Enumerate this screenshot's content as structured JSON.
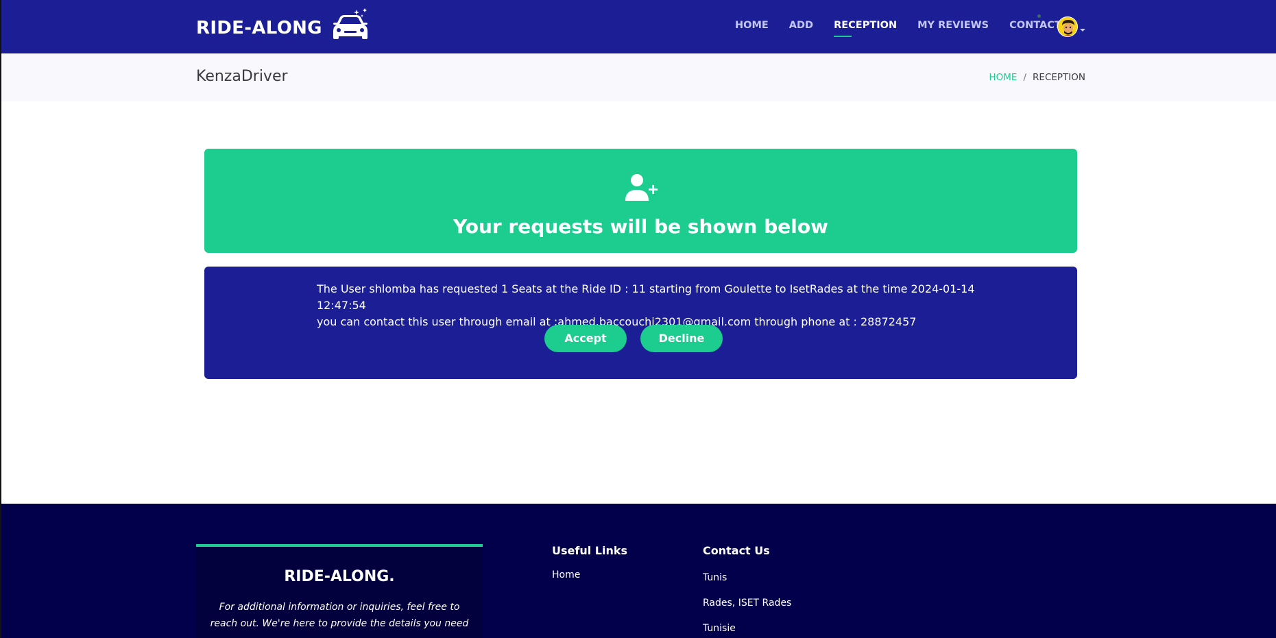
{
  "header": {
    "logo_text": "RIDE-ALONG",
    "nav": [
      {
        "label": "HOME",
        "active": false
      },
      {
        "label": "ADD",
        "active": false
      },
      {
        "label": "RECEPTION",
        "active": true
      },
      {
        "label": "MY REVIEWS",
        "active": false
      },
      {
        "label": "CONTACT",
        "active": false
      }
    ]
  },
  "breadcrumb_bar": {
    "username": "KenzaDriver",
    "crumbs": {
      "home": "HOME",
      "separator": "/",
      "current": "RECEPTION"
    }
  },
  "banner": {
    "icon": "user-plus-icon",
    "title": "Your requests will be shown below"
  },
  "request": {
    "line1": "The User shlomba has requested 1 Seats at the Ride ID : 11 starting from Goulette to IsetRades at the time 2024-01-14 12:47:54",
    "line2": "you can contact this user through email at :ahmed.baccouchi2301@gmail.com through phone at : 28872457",
    "accept_label": "Accept",
    "decline_label": "Decline"
  },
  "footer": {
    "brand": "RIDE-ALONG.",
    "about_text": "For additional information or inquiries, feel free to reach out. We're here to provide the details you need",
    "useful_links_title": "Useful Links",
    "useful_links": [
      "Home"
    ],
    "contact_title": "Contact Us",
    "contact_items": [
      "Tunis",
      "Rades, ISET Rades",
      "Tunisie"
    ]
  },
  "colors": {
    "primary": "#1b1e95",
    "accent": "#1ccd8f",
    "footer_bg": "#02004b"
  }
}
